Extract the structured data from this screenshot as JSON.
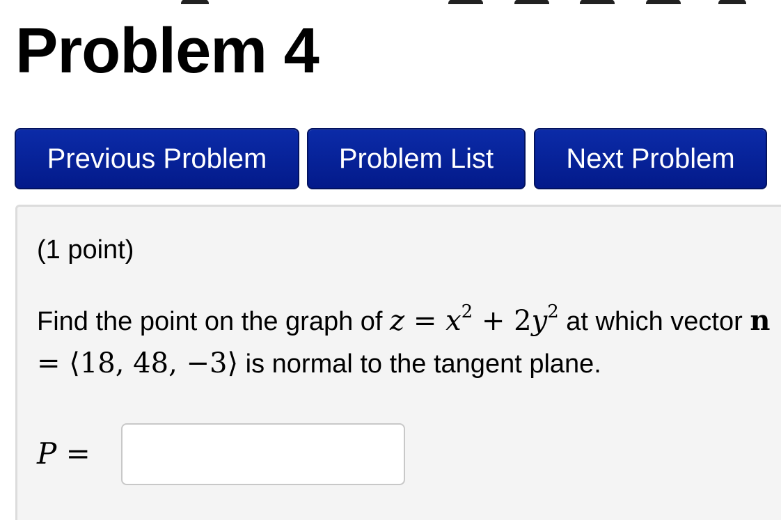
{
  "header": {
    "title": "Problem 4"
  },
  "nav": {
    "previous_label": "Previous Problem",
    "list_label": "Problem List",
    "next_label": "Next Problem"
  },
  "problem": {
    "points": "(1 point)",
    "text_before_eq": "Find the point on the graph of",
    "text_after_eq": "at which vector",
    "text_after_vec": "is normal to the tangent plane.",
    "equation": {
      "lhs": "z",
      "eq": "=",
      "term1_base": "x",
      "term1_exp": "2",
      "plus": "+",
      "term2_coef": "2",
      "term2_base": "y",
      "term2_exp": "2"
    },
    "vector": {
      "name": "n",
      "eq": "=",
      "value": "⟨18, 48, −3⟩"
    },
    "answer_label": "P =",
    "answer_value": ""
  },
  "colors": {
    "button_bg": "#031a8a",
    "panel_bg": "#f4f4f4"
  }
}
